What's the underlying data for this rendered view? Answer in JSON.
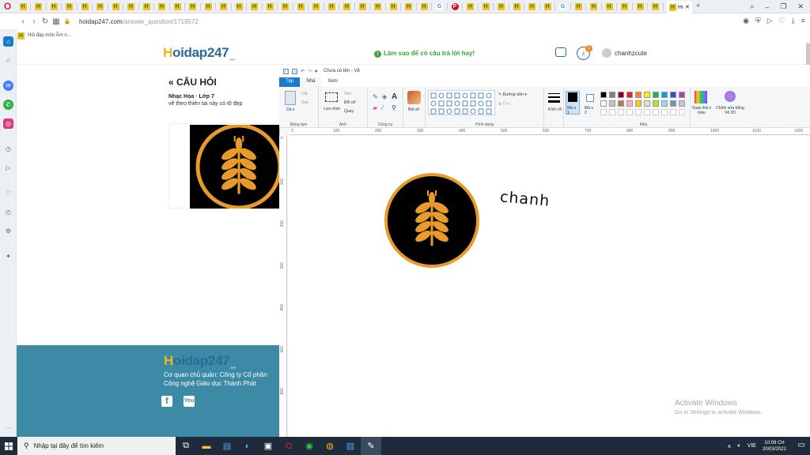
{
  "browser": {
    "active_tab_label": "Hı",
    "url_host": "hoidap247.com",
    "url_path": "/answer_question/1719572",
    "bookmark_label": "Hỏi đáp môn Âm n..."
  },
  "site": {
    "logo_main": "oidap247",
    "logo_initial": "H",
    "logo_sub": ".com",
    "tip": "Làm sao để có câu trả lời hay!",
    "notification_count": "1",
    "username": "chanhzcute",
    "question_header": "« CÂU HỎI",
    "question_subject": "Nhạc Họa · Lớp 7",
    "question_text": "vẽ theo thiên tai này có tô đẹp",
    "footer_org": "Cơ quan chủ quản: Công ty Cổ phần Công nghệ Giáo dục Thành Phát",
    "footer_fb": "f",
    "footer_yt": "You"
  },
  "paint": {
    "title": "Chưa có tên - Vẽ",
    "tabs": [
      "Tệp",
      "Nhà",
      "Xem"
    ],
    "groups": [
      "Bảng tạm",
      "Ảnh",
      "Công cụ",
      "Hình dạng",
      "Màu"
    ],
    "paste": "Dá n",
    "cut": "Cắt",
    "copy": "Sao",
    "select": "Lựa chọn",
    "crop": "Xén",
    "resize": "Đổi cỡ",
    "rotate": "Quay",
    "brush": "Bút vẽ",
    "outline": "Đường viền",
    "fill": "Tô",
    "size": "Kích cỡ",
    "color1": "Mà u 1",
    "color2": "Mà u 2",
    "edit_colors": "Soạn thả o màu",
    "paint3d": "Chỉnh sửa bằng Vẽ 3D",
    "ruler_ticks": [
      "0",
      "100",
      "200",
      "300",
      "400",
      "500",
      "600",
      "700",
      "800",
      "900",
      "1000",
      "1100",
      "1200"
    ],
    "vruler_ticks": [
      "0",
      "100",
      "200",
      "300",
      "400",
      "500",
      "600"
    ],
    "handwritten": "chanh",
    "palette": [
      "#000000",
      "#7f7f7f",
      "#880015",
      "#ed1c24",
      "#ff7f27",
      "#fff200",
      "#22b14c",
      "#00a2e8",
      "#3f48cc",
      "#a349a4",
      "#ffffff",
      "#c3c3c3",
      "#b97a57",
      "#ffaec9",
      "#ffc90e",
      "#efe4b0",
      "#b5e61d",
      "#99d9ea",
      "#7092be",
      "#c8bfe7"
    ]
  },
  "windows": {
    "activate_title": "Activate Windows",
    "activate_sub": "Go to Settings to activate Windows.",
    "search_placeholder": "Nhập tại đây để tìm kiếm",
    "lang": "VIE",
    "time": "10:09 CH",
    "date": "20/03/2021"
  }
}
